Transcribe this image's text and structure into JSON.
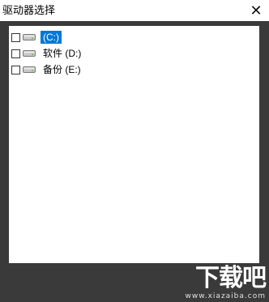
{
  "window": {
    "title": "驱动器选择",
    "close_glyph": "✕"
  },
  "drives": [
    {
      "label": "(C:)",
      "checked": false,
      "selected": true,
      "icon": "drive-icon"
    },
    {
      "label": "软件 (D:)",
      "checked": false,
      "selected": false,
      "icon": "drive-icon"
    },
    {
      "label": "备份 (E:)",
      "checked": false,
      "selected": false,
      "icon": "drive-icon"
    }
  ],
  "watermark": {
    "brand": "下载吧",
    "url": "www.xiazaiba.com"
  },
  "colors": {
    "selection": "#0078d7",
    "frame": "#3a3a3a"
  }
}
